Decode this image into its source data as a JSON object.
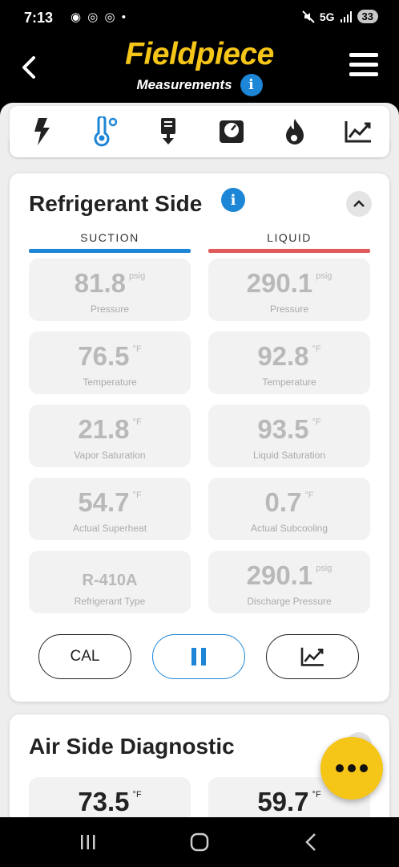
{
  "status_bar": {
    "time": "7:13",
    "left_icons": "◉ ◎ ◎ •",
    "network": "5G",
    "battery": "33"
  },
  "header": {
    "brand": "Fieldpiece",
    "subtitle": "Measurements"
  },
  "tabs": [
    {
      "name": "electrical",
      "icon": "lightning-icon"
    },
    {
      "name": "temperature",
      "icon": "thermometer-icon"
    },
    {
      "name": "probe",
      "icon": "probe-icon"
    },
    {
      "name": "gauge",
      "icon": "gauge-icon"
    },
    {
      "name": "combustion",
      "icon": "flame-icon"
    },
    {
      "name": "graph",
      "icon": "chart-icon"
    }
  ],
  "refrigerant": {
    "title": "Refrigerant Side",
    "suction_label": "SUCTION",
    "liquid_label": "LIQUID",
    "suction_color": "#1d86d6",
    "liquid_color": "#e05a5a",
    "suction": [
      {
        "value": "81.8",
        "unit": "psig",
        "label": "Pressure"
      },
      {
        "value": "76.5",
        "unit": "°F",
        "label": "Temperature"
      },
      {
        "value": "21.8",
        "unit": "°F",
        "label": "Vapor Saturation"
      },
      {
        "value": "54.7",
        "unit": "°F",
        "label": "Actual Superheat"
      },
      {
        "value": "R-410A",
        "unit": "",
        "label": "Refrigerant Type"
      }
    ],
    "liquid": [
      {
        "value": "290.1",
        "unit": "psig",
        "label": "Pressure"
      },
      {
        "value": "92.8",
        "unit": "°F",
        "label": "Temperature"
      },
      {
        "value": "93.5",
        "unit": "°F",
        "label": "Liquid Saturation"
      },
      {
        "value": "0.7",
        "unit": "°F",
        "label": "Actual Subcooling"
      },
      {
        "value": "290.1",
        "unit": "psig",
        "label": "Discharge Pressure"
      }
    ],
    "buttons": {
      "cal": "CAL"
    }
  },
  "air_side": {
    "title": "Air Side Diagnostic",
    "tiles": [
      {
        "value": "73.5",
        "unit": "°F"
      },
      {
        "value": "59.7",
        "unit": "°F"
      }
    ]
  },
  "colors": {
    "brand": "#f5c518",
    "accent": "#1d86d6"
  }
}
